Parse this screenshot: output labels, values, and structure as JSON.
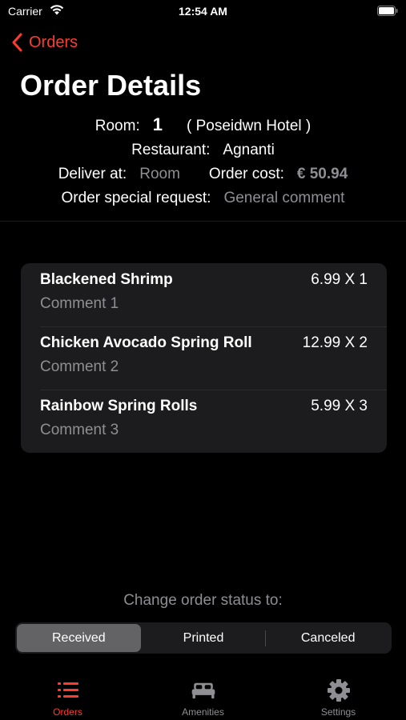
{
  "status_bar": {
    "carrier": "Carrier",
    "time": "12:54 AM"
  },
  "nav": {
    "back_label": "Orders"
  },
  "page_title": "Order Details",
  "order": {
    "room_label": "Room:",
    "room_number": "1",
    "hotel": "( Poseidwn Hotel )",
    "restaurant_label": "Restaurant:",
    "restaurant": "Agnanti",
    "deliver_label": "Deliver at:",
    "deliver_value": "Room",
    "cost_label": "Order cost:",
    "cost_value": "€ 50.94",
    "special_request_label": "Order special request:",
    "special_request_value": "General comment"
  },
  "items": [
    {
      "name": "Blackened Shrimp",
      "comment": "Comment 1",
      "price_qty": "6.99 X 1"
    },
    {
      "name": "Chicken Avocado Spring Roll",
      "comment": "Comment 2",
      "price_qty": "12.99 X 2"
    },
    {
      "name": "Rainbow Spring Rolls",
      "comment": "Comment 3",
      "price_qty": "5.99 X 3"
    }
  ],
  "status_change": {
    "prompt": "Change order status to:",
    "options": [
      "Received",
      "Printed",
      "Canceled"
    ],
    "selected": "Received"
  },
  "tab_bar": {
    "tabs": [
      {
        "label": "Orders",
        "icon": "list-icon",
        "active": true
      },
      {
        "label": "Amenities",
        "icon": "bed-icon",
        "active": false
      },
      {
        "label": "Settings",
        "icon": "gear-icon",
        "active": false
      }
    ]
  },
  "colors": {
    "accent": "#ff3b30",
    "background": "#000000",
    "card": "#1c1c1e",
    "muted_text": "#8e8e93",
    "segment_selected": "#636366"
  }
}
